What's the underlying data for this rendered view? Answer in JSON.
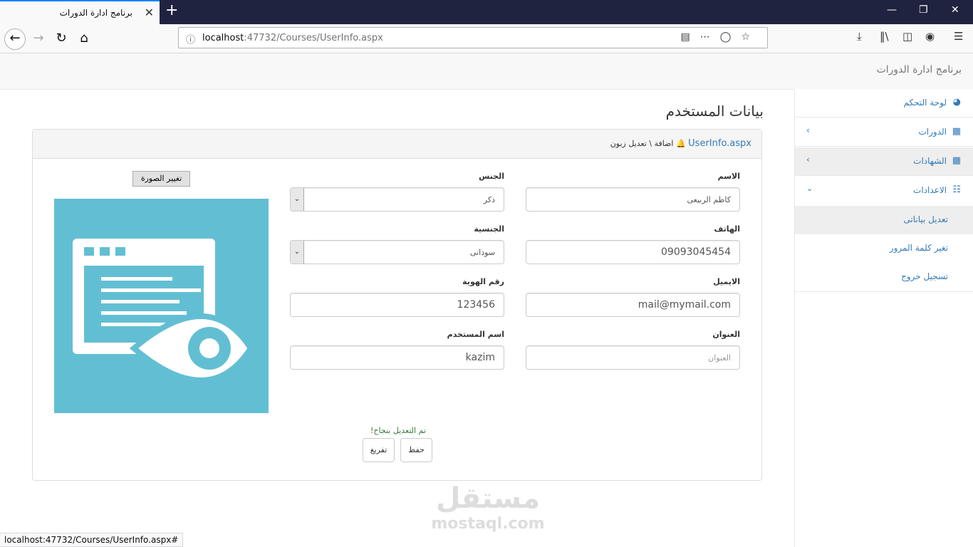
{
  "browser": {
    "tab_title": "برنامج ادارة الدورات",
    "tab_close": "✕",
    "new_tab": "+",
    "url_host": "localhost",
    "url_path": ":47732/Courses/UserInfo.aspx",
    "status_url": "localhost:47732/Courses/UserInfo.aspx#"
  },
  "app": {
    "brand": "برنامج ادارة الدورات"
  },
  "sidebar": {
    "items": [
      {
        "label": "لوحة التحكم",
        "icon": "dashboard-icon"
      },
      {
        "label": "الدورات",
        "icon": "bar-chart-icon"
      },
      {
        "label": "الشهادات",
        "icon": "bar-chart-icon"
      },
      {
        "label": "الاعدادات",
        "icon": "sitemap-icon"
      }
    ],
    "sub_items": [
      {
        "label": "تعديل بياناتى"
      },
      {
        "label": "تغير كلمة المرور"
      },
      {
        "label": "تسجيل خروج"
      }
    ]
  },
  "page": {
    "title": "بيانات المستخدم",
    "breadcrumb_link": "UserInfo.aspx",
    "breadcrumb_text": "اضافة \\ تعديل زبون"
  },
  "form": {
    "name_label": "الاسم",
    "name_value": "كاظم الربيعى",
    "gender_label": "الجنس",
    "gender_value": "ذكر",
    "phone_label": "الهاتف",
    "phone_value": "09093045454",
    "nationality_label": "الجنسية",
    "nationality_value": "سودانى",
    "email_label": "الايميل",
    "email_value": "mail@mymail.com",
    "id_label": "رقم الهوية",
    "id_value": "123456",
    "address_label": "العنوان",
    "address_placeholder": "العنوان",
    "username_label": "اسم المستخدم",
    "username_value": "kazim",
    "change_photo": "تغيير الصورة",
    "success_message": "تم التعديل بنجاح!",
    "save": "حفظ",
    "clear": "تفريغ"
  },
  "watermark": {
    "arabic": "مستقل",
    "latin": "mostaql.com"
  },
  "colors": {
    "link": "#337ab7",
    "photo_bg": "#62bfd3",
    "success": "#3c763d",
    "titlebar": "#202340"
  }
}
